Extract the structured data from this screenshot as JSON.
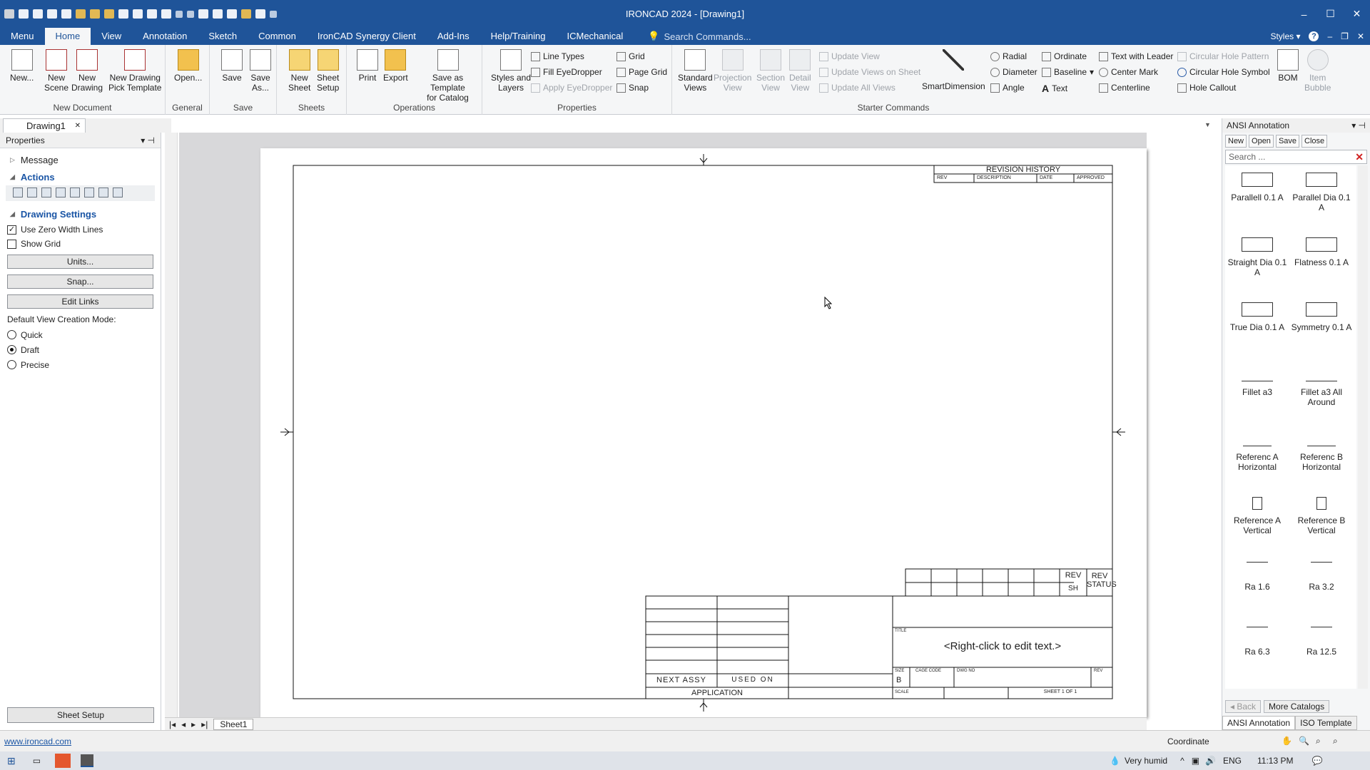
{
  "window": {
    "title": "IRONCAD 2024 - [Drawing1]",
    "minimize": "–",
    "maximize": "☐",
    "close": "✕"
  },
  "menu": {
    "tabs": [
      "Menu",
      "Home",
      "View",
      "Annotation",
      "Sketch",
      "Common",
      "IronCAD Synergy Client",
      "Add-Ins",
      "Help/Training",
      "ICMechanical"
    ],
    "search_placeholder": "Search Commands...",
    "styles": "Styles",
    "help": "?"
  },
  "ribbon": {
    "new_document": {
      "label": "New Document",
      "new": "New...",
      "new_scene_1": "New",
      "new_scene_2": "Scene",
      "new_drawing_1": "New",
      "new_drawing_2": "Drawing",
      "new_pick_1": "New Drawing",
      "new_pick_2": "Pick Template"
    },
    "general": {
      "label": "General",
      "open": "Open..."
    },
    "save": {
      "label": "Save",
      "save": "Save",
      "save_as_1": "Save",
      "save_as_2": "As..."
    },
    "sheets": {
      "label": "Sheets",
      "new_sheet_1": "New",
      "new_sheet_2": "Sheet",
      "sheet_setup_1": "Sheet",
      "sheet_setup_2": "Setup"
    },
    "operations": {
      "label": "Operations",
      "print": "Print",
      "export": "Export",
      "template_1": "Save as Template",
      "template_2": "for Catalog"
    },
    "properties": {
      "label": "Properties",
      "styles_1": "Styles and",
      "styles_2": "Layers",
      "line_types": "Line Types",
      "fill_eyedropper": "Fill EyeDropper",
      "apply_eyedropper": "Apply EyeDropper",
      "grid": "Grid",
      "page_grid": "Page Grid",
      "snap": "Snap"
    },
    "views": {
      "standard_1": "Standard",
      "standard_2": "Views",
      "projection_1": "Projection",
      "projection_2": "View",
      "section_1": "Section",
      "section_2": "View",
      "detail_1": "Detail",
      "detail_2": "View",
      "update_view": "Update View",
      "update_views_sheet": "Update Views on Sheet",
      "update_all": "Update All Views"
    },
    "starter": {
      "label": "Starter Commands",
      "smartdim": "SmartDimension",
      "radial": "Radial",
      "diameter": "Diameter",
      "angle": "Angle",
      "ordinate": "Ordinate",
      "baseline": "Baseline",
      "text": "Text",
      "text_leader": "Text with Leader",
      "center_mark": "Center Mark",
      "centerline": "Centerline",
      "circ_pattern": "Circular Hole Pattern",
      "circ_symbol": "Circular Hole Symbol",
      "hole_callout": "Hole Callout",
      "bom": "BOM",
      "item_1": "Item",
      "item_2": "Bubble"
    }
  },
  "doc_tab": {
    "name": "Drawing1",
    "close": "✕"
  },
  "properties_panel": {
    "title": "Properties",
    "message": "Message",
    "actions": "Actions",
    "drawing_settings": "Drawing Settings",
    "use_zero_width": "Use Zero Width Lines",
    "use_zero_width_checked": true,
    "show_grid": "Show Grid",
    "show_grid_checked": false,
    "units_btn": "Units...",
    "snap_btn": "Snap...",
    "edit_links_btn": "Edit Links",
    "default_mode_label": "Default View Creation Mode:",
    "modes": [
      "Quick",
      "Draft",
      "Precise"
    ],
    "selected_mode": "Draft",
    "sheet_setup_btn": "Sheet Setup"
  },
  "drawing": {
    "revision_history": "REVISION HISTORY",
    "rev_cols": [
      "REV",
      "DESCRIPTION",
      "DATE",
      "APPROVED"
    ],
    "rev": "REV",
    "sh": "SH",
    "rev_status_1": "REV",
    "rev_status_2": "STATUS",
    "next_assy": "NEXT ASSY",
    "used_on": "USED ON",
    "application": "APPLICATION",
    "title_lbl": "TITLE",
    "title_text": "<Right-click to edit text.>",
    "size_lbl": "SIZE",
    "size": "B",
    "cage_code": "CAGE CODE",
    "dwg_no": "DWG NO",
    "rev_lbl": "REV",
    "scale": "SCALE",
    "sheet": "SHEET 1 OF 1"
  },
  "sheet_tabs": [
    "Sheet1"
  ],
  "catalog": {
    "title": "ANSI Annotation",
    "tools": [
      "New",
      "Open",
      "Save",
      "Close"
    ],
    "search_placeholder": "Search ...",
    "items": [
      "Parallell 0.1 A",
      "Parallel Dia 0.1 A",
      "Straight Dia 0.1 A",
      "Flatness 0.1 A",
      "True Dia 0.1 A",
      "Symmetry 0.1 A",
      "Fillet a3",
      "Fillet a3 All Around",
      "Referenc A Horizontal",
      "Referenc B Horizontal",
      "Reference A Vertical",
      "Reference B Vertical",
      "Ra 1.6",
      "Ra 3.2",
      "Ra 6.3",
      "Ra 12.5"
    ],
    "back": "Back",
    "more": "More Catalogs",
    "tabs": [
      "ANSI Annotation",
      "ISO Template"
    ]
  },
  "status": {
    "website": "www.ironcad.com",
    "coordinate": "Coordinate"
  },
  "taskbar": {
    "weather": "Very humid",
    "lang": "ENG",
    "time": "11:13 PM"
  }
}
